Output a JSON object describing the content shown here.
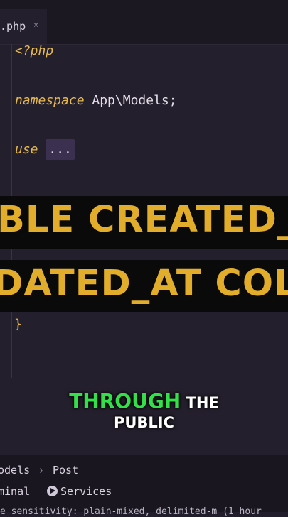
{
  "editor": {
    "tab": {
      "name": ".php",
      "close": "×"
    },
    "code": {
      "line1": "<?php",
      "line2_kw": "namespace",
      "line2_rest": " App\\Models;",
      "line3_kw": "use",
      "line3_ellipsis": "...",
      "closing_brace": "}"
    }
  },
  "overlay": {
    "banner1": "BLE CREATED_AT",
    "banner2": "DATED_AT COLU",
    "subtitle_green": "THROUGH",
    "subtitle_white1": " THE",
    "subtitle_white2": "PUBLIC"
  },
  "status": {
    "breadcrumb": [
      "odels",
      "Post"
    ],
    "breadcrumb_sep": "›",
    "tabs": [
      "minal",
      "Services"
    ],
    "statusline": "e sensitivity: plain-mixed, delimited-m   (1 hour"
  },
  "colors": {
    "keyword": "#e5b951",
    "banner_text": "#e2ad2b",
    "subtitle_green": "#34e04a"
  }
}
